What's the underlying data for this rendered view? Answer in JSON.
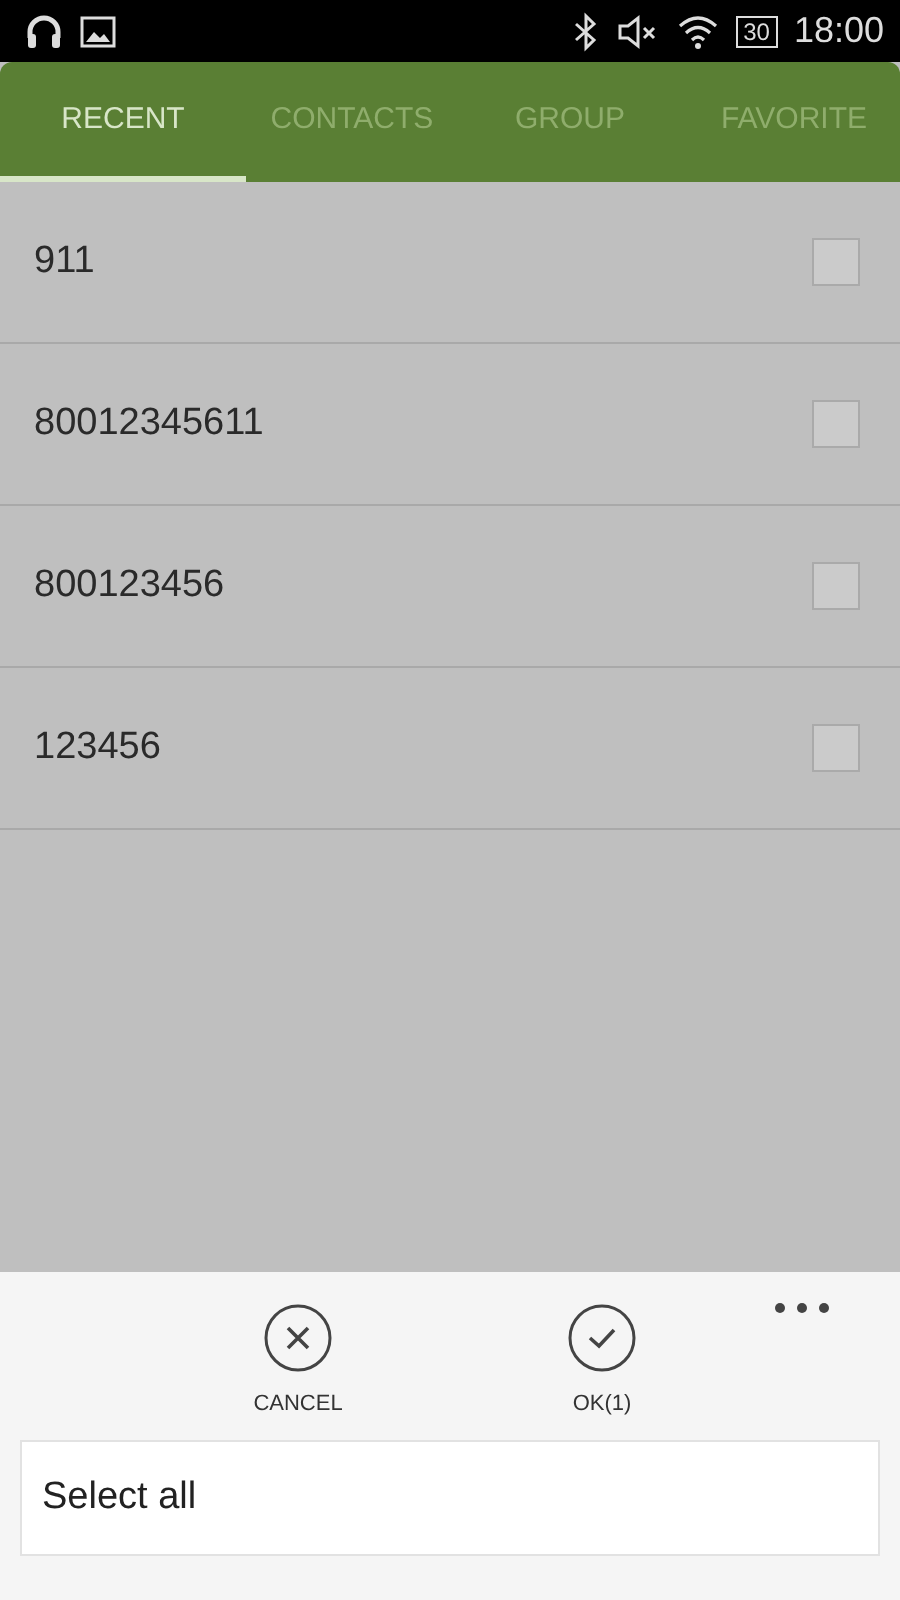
{
  "status_bar": {
    "battery": "30",
    "time": "18:00"
  },
  "tabs": [
    {
      "label": "RECENT",
      "selected": true
    },
    {
      "label": "CONTACTS",
      "selected": false
    },
    {
      "label": "GROUP",
      "selected": false
    },
    {
      "label": "FAVORITE",
      "selected": false
    }
  ],
  "list": [
    {
      "number": "911",
      "checked": false
    },
    {
      "number": "80012345611",
      "checked": false
    },
    {
      "number": "800123456",
      "checked": false
    },
    {
      "number": "123456",
      "checked": false
    }
  ],
  "actions": [
    {
      "kind": "cancel",
      "label": "CANCEL"
    },
    {
      "kind": "ok",
      "label": "OK(1)"
    }
  ],
  "menu": {
    "items": [
      "Select all"
    ]
  }
}
